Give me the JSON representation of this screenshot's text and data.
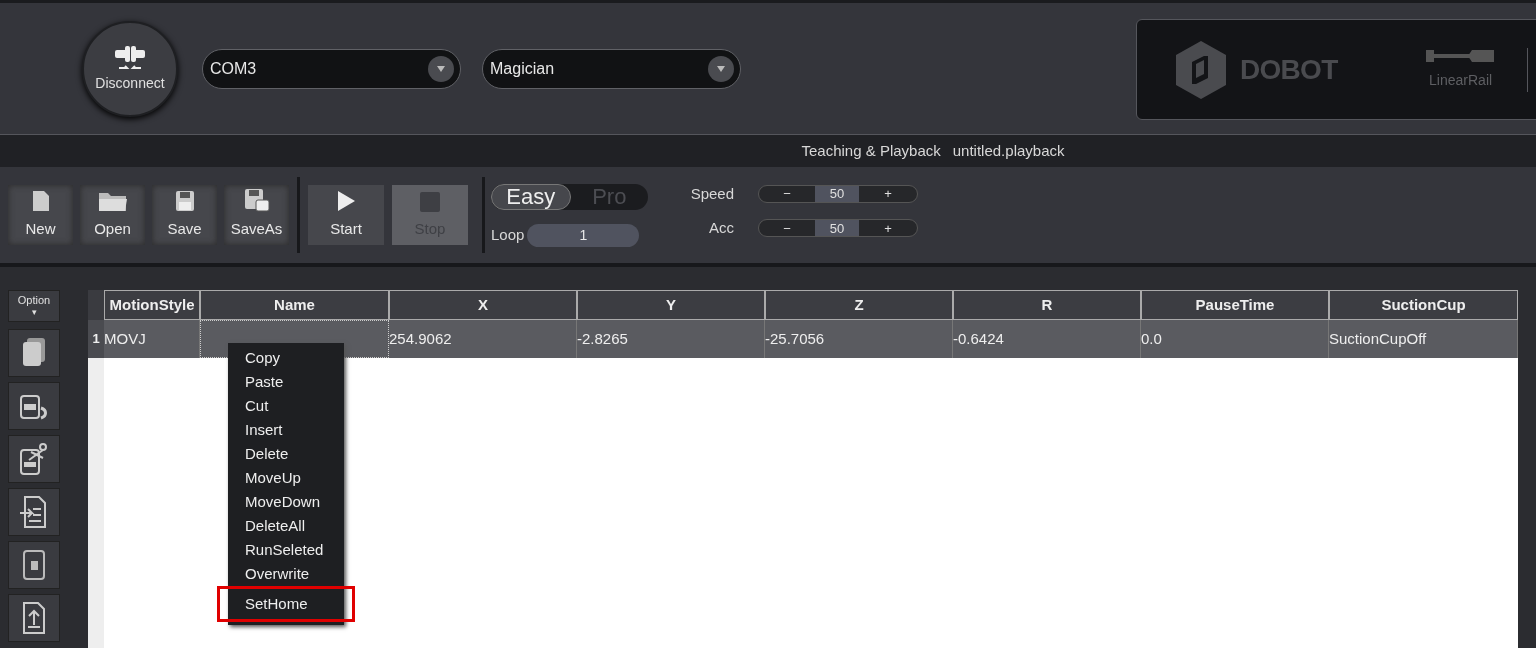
{
  "connection": {
    "button": "Disconnect",
    "port": "COM3",
    "device": "Magician"
  },
  "brand": {
    "logo": "DOBOT",
    "accessory": "LinearRail"
  },
  "title_bar": {
    "module": "Teaching & Playback",
    "file": "untitled.playback"
  },
  "toolbar": {
    "file_buttons": [
      {
        "label": "New",
        "kind": "new"
      },
      {
        "label": "Open",
        "kind": "open"
      },
      {
        "label": "Save",
        "kind": "save"
      },
      {
        "label": "SaveAs",
        "kind": "saveas"
      }
    ],
    "run_buttons": [
      {
        "label": "Start",
        "kind": "start",
        "disabled": false
      },
      {
        "label": "Stop",
        "kind": "stop",
        "disabled": true
      }
    ],
    "modes": [
      {
        "label": "Easy",
        "selected": true
      },
      {
        "label": "Pro",
        "selected": false
      }
    ],
    "loop": {
      "label": "Loop",
      "value": "1"
    },
    "steppers": [
      {
        "label": "Speed",
        "minus": "−",
        "value": "50",
        "plus": "+"
      },
      {
        "label": "Acc",
        "minus": "−",
        "value": "50",
        "plus": "+"
      }
    ]
  },
  "side_panel": {
    "option": "Option",
    "option_caret": "▾",
    "buttons": [
      {
        "kind": "copy"
      },
      {
        "kind": "paste"
      },
      {
        "kind": "cut"
      },
      {
        "kind": "insert"
      },
      {
        "kind": "save"
      },
      {
        "kind": "export"
      }
    ]
  },
  "table": {
    "columns": [
      "MotionStyle",
      "Name",
      "X",
      "Y",
      "Z",
      "R",
      "PauseTime",
      "SuctionCup"
    ],
    "rows": [
      {
        "number": "1",
        "cells": [
          "MOVJ",
          "",
          "254.9062",
          "-2.8265",
          "-25.7056",
          "-0.6424",
          "0.0",
          "SuctionCupOff"
        ]
      }
    ]
  },
  "context_menu": [
    {
      "label": "Copy",
      "highlighted": false
    },
    {
      "label": "Paste",
      "highlighted": false
    },
    {
      "label": "Cut",
      "highlighted": false
    },
    {
      "label": "Insert",
      "highlighted": false
    },
    {
      "label": "Delete",
      "highlighted": false
    },
    {
      "label": "MoveUp",
      "highlighted": false
    },
    {
      "label": "MoveDown",
      "highlighted": false
    },
    {
      "label": "DeleteAll",
      "highlighted": false
    },
    {
      "label": "RunSeleted",
      "highlighted": false
    },
    {
      "label": "Overwrite",
      "highlighted": false
    },
    {
      "label": "SetHome",
      "highlighted": true
    }
  ]
}
